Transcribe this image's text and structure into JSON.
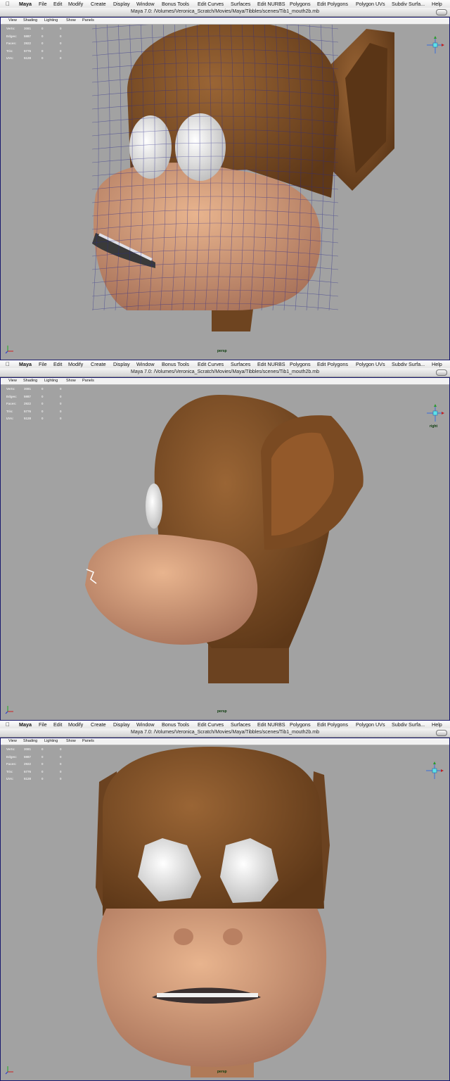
{
  "menubar": {
    "app": "Maya",
    "items": [
      "File",
      "Edit",
      "Modify",
      "Create",
      "Display",
      "Window",
      "Bonus Tools",
      "Edit Curves",
      "Surfaces",
      "Edit NURBS",
      "Polygons",
      "Edit Polygons",
      "Polygon UVs",
      "Subdiv Surfa...",
      "Help"
    ]
  },
  "window_title": "Maya 7.0: /Volumes/Veronica_Scratch/Movies/Maya/Tibbles/scenes/Tib1_mouth2b.mb",
  "panel_menu": [
    "View",
    "Shading",
    "Lighting",
    "Show",
    "Panels"
  ],
  "stats": [
    {
      "label": "Verts:",
      "v1": "3081",
      "v2": "0",
      "v3": "0"
    },
    {
      "label": "Edges:",
      "v1": "5987",
      "v2": "0",
      "v3": "0"
    },
    {
      "label": "Faces:",
      "v1": "2922",
      "v2": "0",
      "v3": "0"
    },
    {
      "label": "Tris:",
      "v1": "5776",
      "v2": "0",
      "v3": "0"
    },
    {
      "label": "UVs:",
      "v1": "5128",
      "v2": "0",
      "v3": "0"
    }
  ],
  "views": [
    {
      "camera": "persp",
      "cube_label": "",
      "display": "wireframe-on-shaded"
    },
    {
      "camera": "persp",
      "cube_label": "right",
      "display": "shaded"
    },
    {
      "camera": "persp",
      "cube_label": "",
      "display": "shaded"
    }
  ],
  "colors": {
    "fur": "#7a4b25",
    "skin": "#d9a07a",
    "eye": "#f2f2f2",
    "viewport_bg": "#a2a2a2",
    "wire": "#2a2a8a"
  },
  "icons": [
    "apple-icon",
    "view-cube-icon",
    "axis-icon"
  ]
}
